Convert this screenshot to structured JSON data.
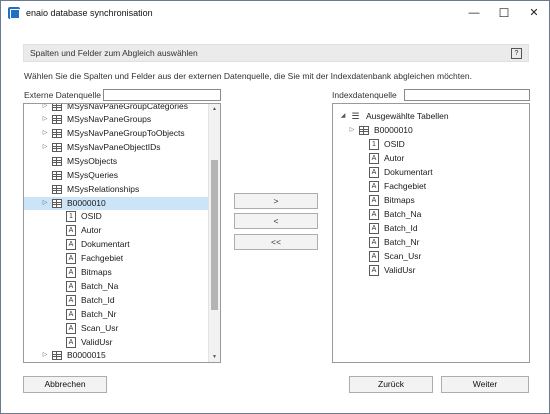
{
  "window": {
    "title": "enaio database synchronisation",
    "minimize_glyph": "—",
    "maximize_glyph": "☐",
    "close_glyph": "✕"
  },
  "section": {
    "title": "Spalten und Felder zum Abgleich auswählen",
    "help_glyph": "?",
    "instruction": "Wählen Sie die Spalten und Felder aus der externen Datenquelle, die Sie mit der Indexdatenbank abgleichen möchten."
  },
  "left": {
    "label": "Externe Datenquelle",
    "filter_value": "",
    "rows": [
      {
        "label": "MSysNavPaneGroupCategories",
        "icon": "table-icon",
        "expander": "▷",
        "level": 0
      },
      {
        "label": "MSysNavPaneGroups",
        "icon": "table-icon",
        "expander": "▷",
        "level": 0
      },
      {
        "label": "MSysNavPaneGroupToObjects",
        "icon": "table-icon",
        "expander": "▷",
        "level": 0
      },
      {
        "label": "MSysNavPaneObjectIDs",
        "icon": "table-icon",
        "expander": "▷",
        "level": 0
      },
      {
        "label": "MSysObjects",
        "icon": "table-icon",
        "expander": "",
        "level": 0
      },
      {
        "label": "MSysQueries",
        "icon": "table-icon",
        "expander": "",
        "level": 0
      },
      {
        "label": "MSysRelationships",
        "icon": "table-icon",
        "expander": "",
        "level": 0
      },
      {
        "label": "B0000010",
        "icon": "table-icon",
        "expander": "▷",
        "level": 0,
        "selected": true
      },
      {
        "label": "OSID",
        "icon": "numeric-field-icon",
        "glyph": "1",
        "expander": "",
        "level": 1
      },
      {
        "label": "Autor",
        "icon": "text-field-icon",
        "glyph": "A",
        "expander": "",
        "level": 1
      },
      {
        "label": "Dokumentart",
        "icon": "text-field-icon",
        "glyph": "A",
        "expander": "",
        "level": 1
      },
      {
        "label": "Fachgebiet",
        "icon": "text-field-icon",
        "glyph": "A",
        "expander": "",
        "level": 1
      },
      {
        "label": "Bitmaps",
        "icon": "text-field-icon",
        "glyph": "A",
        "expander": "",
        "level": 1
      },
      {
        "label": "Batch_Na",
        "icon": "text-field-icon",
        "glyph": "A",
        "expander": "",
        "level": 1
      },
      {
        "label": "Batch_Id",
        "icon": "text-field-icon",
        "glyph": "A",
        "expander": "",
        "level": 1
      },
      {
        "label": "Batch_Nr",
        "icon": "text-field-icon",
        "glyph": "A",
        "expander": "",
        "level": 1
      },
      {
        "label": "Scan_Usr",
        "icon": "text-field-icon",
        "glyph": "A",
        "expander": "",
        "level": 1
      },
      {
        "label": "ValidUsr",
        "icon": "text-field-icon",
        "glyph": "A",
        "expander": "",
        "level": 1
      },
      {
        "label": "B0000015",
        "icon": "table-icon",
        "expander": "▷",
        "level": 0
      }
    ]
  },
  "middle": {
    "add_label": ">",
    "remove_label": "<",
    "remove_all_label": "<<"
  },
  "right": {
    "label": "Indexdatenquelle",
    "filter_value": "",
    "root_label": "Ausgewählte Tabellen",
    "root_expander": "◢",
    "rows": [
      {
        "label": "B0000010",
        "icon": "table-icon",
        "expander": "▷",
        "level": 1
      },
      {
        "label": "OSID",
        "icon": "numeric-field-icon",
        "glyph": "1",
        "expander": "",
        "level": 2
      },
      {
        "label": "Autor",
        "icon": "text-field-icon",
        "glyph": "A",
        "expander": "",
        "level": 2
      },
      {
        "label": "Dokumentart",
        "icon": "text-field-icon",
        "glyph": "A",
        "expander": "",
        "level": 2
      },
      {
        "label": "Fachgebiet",
        "icon": "text-field-icon",
        "glyph": "A",
        "expander": "",
        "level": 2
      },
      {
        "label": "Bitmaps",
        "icon": "text-field-icon",
        "glyph": "A",
        "expander": "",
        "level": 2
      },
      {
        "label": "Batch_Na",
        "icon": "text-field-icon",
        "glyph": "A",
        "expander": "",
        "level": 2
      },
      {
        "label": "Batch_Id",
        "icon": "text-field-icon",
        "glyph": "A",
        "expander": "",
        "level": 2
      },
      {
        "label": "Batch_Nr",
        "icon": "text-field-icon",
        "glyph": "A",
        "expander": "",
        "level": 2
      },
      {
        "label": "Scan_Usr",
        "icon": "text-field-icon",
        "glyph": "A",
        "expander": "",
        "level": 2
      },
      {
        "label": "ValidUsr",
        "icon": "text-field-icon",
        "glyph": "A",
        "expander": "",
        "level": 2
      }
    ]
  },
  "footer": {
    "cancel_label": "Abbrechen",
    "back_label": "Zurück",
    "next_label": "Weiter"
  }
}
